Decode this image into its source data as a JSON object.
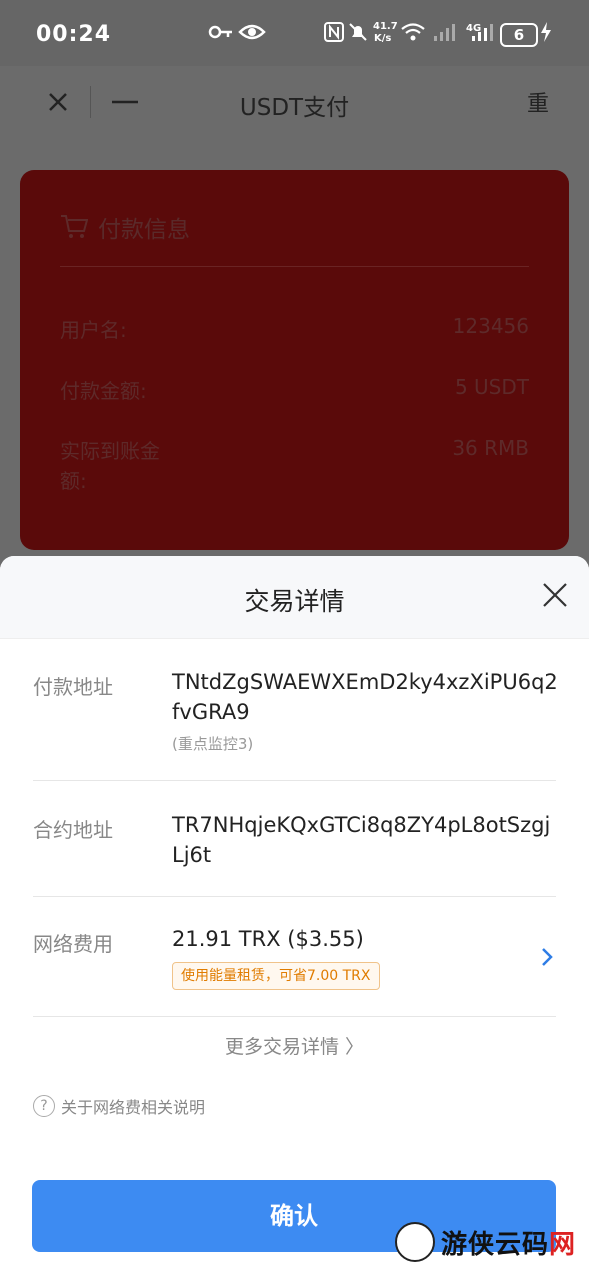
{
  "status_bar": {
    "time": "00:24",
    "speed_top": "41.7",
    "speed_unit": "K/s",
    "net": "4G",
    "battery": "6"
  },
  "nav": {
    "title": "USDT支付",
    "close_label": "✕",
    "minimize_label": "—",
    "right_label": "重"
  },
  "payment_card": {
    "title": "付款信息",
    "rows": [
      {
        "label": "用户名:",
        "value": "123456"
      },
      {
        "label": "付款金额:",
        "value": "5 USDT"
      },
      {
        "label": "实际到账金额:",
        "value": "36 RMB"
      }
    ]
  },
  "sheet": {
    "title": "交易详情",
    "payment_address_label": "付款地址",
    "payment_address": "TNtdZgSWAEWXEmD2ky4xzXiPU6q2fvGRA9",
    "payment_address_note": "(重点监控3)",
    "contract_address_label": "合约地址",
    "contract_address": "TR7NHqjeKQxGTCi8q8ZY4pL8otSzgjLj6t",
    "network_fee_label": "网络费用",
    "network_fee": "21.91 TRX ($3.55)",
    "energy_badge": "使用能量租赁，可省7.00 TRX",
    "more_details": "更多交易详情 〉",
    "help_text": "关于网络费相关说明",
    "confirm_label": "确认"
  },
  "watermark": {
    "text_main": "游侠云码",
    "text_red": "网"
  }
}
